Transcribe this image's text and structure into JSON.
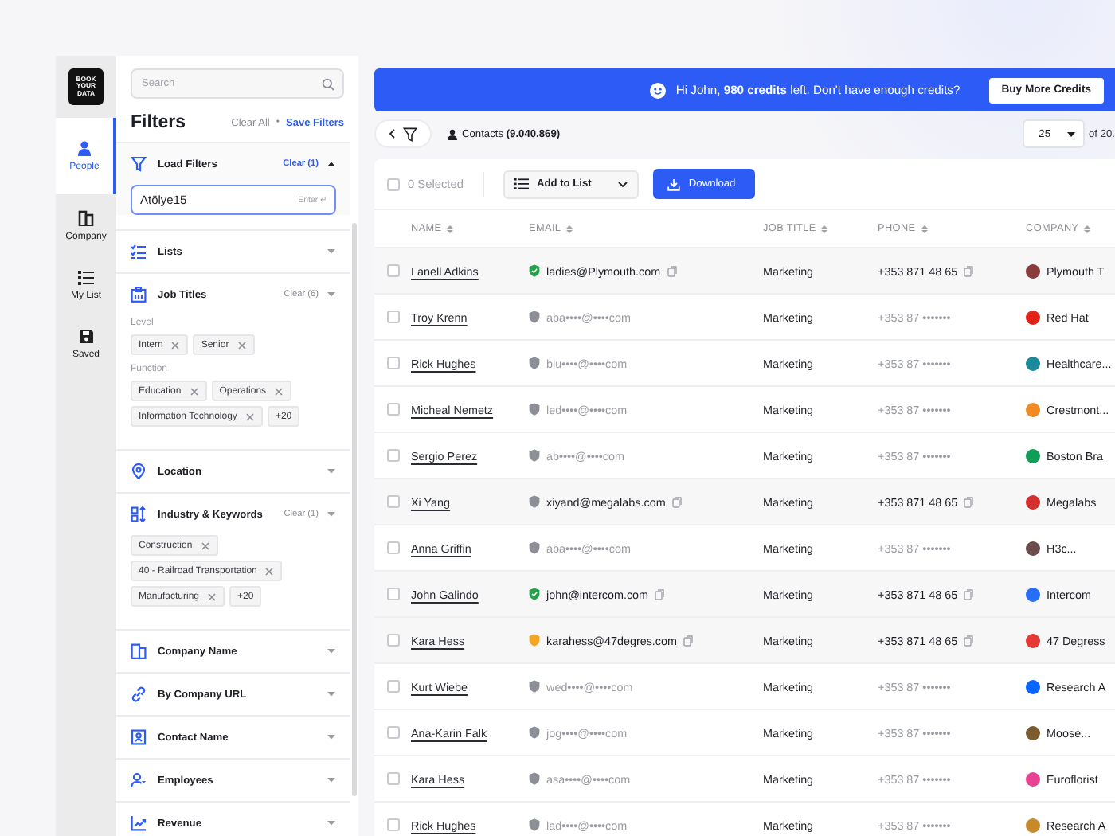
{
  "nav": {
    "logo": "BOOK YOUR DATA",
    "items": [
      {
        "label": "People",
        "selected": true
      },
      {
        "label": "Company",
        "selected": false
      },
      {
        "label": "My List",
        "selected": false
      },
      {
        "label": "Saved",
        "selected": false
      }
    ]
  },
  "filters": {
    "search": {
      "placeholder": "Search"
    },
    "title": "Filters",
    "clear_all": "Clear All",
    "separator": "•",
    "save": "Save Filters",
    "sections": [
      {
        "label": "Load Filters",
        "clear": "Clear (1)",
        "expanded": true,
        "input": {
          "value": "Atölye15",
          "hint": "Enter ↵"
        }
      },
      {
        "label": "Lists",
        "expanded": false
      },
      {
        "label": "Job Titles",
        "clear": "Clear (6)",
        "expanded": false,
        "groups": [
          {
            "label": "Level",
            "chips": [
              "Intern",
              "Senior"
            ]
          },
          {
            "label": "Function",
            "chips": [
              "Education",
              "Operations",
              "Information Technology"
            ],
            "more": "+20"
          }
        ]
      },
      {
        "label": "Location",
        "expanded": false
      },
      {
        "label": "Industry & Keywords",
        "clear": "Clear (1)",
        "expanded": false,
        "groups": [
          {
            "chips": [
              "Construction",
              "40 - Railroad Transportation",
              "Manufacturing"
            ],
            "more": "+20"
          }
        ]
      },
      {
        "label": "Company Name",
        "expanded": false
      },
      {
        "label": "By Company URL",
        "expanded": false
      },
      {
        "label": "Contact Name",
        "expanded": false
      },
      {
        "label": "Employees",
        "expanded": false
      },
      {
        "label": "Revenue",
        "expanded": false
      }
    ]
  },
  "banner": {
    "message": "Hi John, **980 credits** left. Don't have enough credits?",
    "button": "Buy More Credits"
  },
  "toolbar": {
    "contacts": "Contacts **(9.040.869)**",
    "page_size": "25",
    "page_of": "of 20."
  },
  "actions": {
    "select_all": {
      "checked": false
    },
    "selected_count": "0 Selected",
    "add_to_list": "Add to List",
    "download": "Download"
  },
  "table": {
    "columns": [
      "NAME",
      "EMAIL",
      "JOB TITLE",
      "PHONE",
      "COMPANY"
    ],
    "rows": [
      {
        "selected": false,
        "revealed": true,
        "kind": "verified",
        "name": "Lanell Adkins",
        "email": "ladies@Plymouth.com",
        "job_title": "Marketing",
        "phone": "+353 871 48 65",
        "company": "Plymouth T",
        "color": "#8a3b3b"
      },
      {
        "selected": false,
        "revealed": false,
        "kind": "unverified",
        "name": "Troy Krenn",
        "email": "aba••••@••••com",
        "job_title": "Marketing",
        "phone": "+353 87 •••••••",
        "company": "Red Hat",
        "color": "#e2231a"
      },
      {
        "selected": false,
        "revealed": false,
        "kind": "unverified",
        "name": "Rick Hughes",
        "email": "blu••••@••••com",
        "job_title": "Marketing",
        "phone": "+353 87 •••••••",
        "company": "Healthcare...",
        "color": "#1a8a9a"
      },
      {
        "selected": false,
        "revealed": false,
        "kind": "unverified",
        "name": "Micheal Nemetz",
        "email": "led••••@••••com",
        "job_title": "Marketing",
        "phone": "+353 87 •••••••",
        "company": "Crestmont...",
        "color": "#f08a24"
      },
      {
        "selected": false,
        "revealed": false,
        "kind": "unverified",
        "name": "Sergio Perez",
        "email": "ab••••@••••com",
        "job_title": "Marketing",
        "phone": "+353 87 •••••••",
        "company": "Boston Bra",
        "color": "#0f9d58"
      },
      {
        "selected": false,
        "revealed": true,
        "kind": "unverified",
        "name": "Xi Yang",
        "email": "xiyand@megalabs.com",
        "job_title": "Marketing",
        "phone": "+353 871 48 65",
        "company": "Megalabs",
        "color": "#d32f2f"
      },
      {
        "selected": false,
        "revealed": false,
        "kind": "unverified",
        "name": "Anna Griffin",
        "email": "aba••••@••••com",
        "job_title": "Marketing",
        "phone": "+353 87 •••••••",
        "company": "H3c...",
        "color": "#6b4b4b"
      },
      {
        "selected": false,
        "revealed": true,
        "kind": "verified",
        "name": "John Galindo",
        "email": "john@intercom.com",
        "job_title": "Marketing",
        "phone": "+353 871 48 65",
        "company": "Intercom",
        "color": "#286efa"
      },
      {
        "selected": false,
        "revealed": true,
        "kind": "risky",
        "name": "Kara Hess",
        "email": "karahess@47degres.com",
        "job_title": "Marketing",
        "phone": "+353 871 48 65",
        "company": "47 Degress",
        "color": "#e53935"
      },
      {
        "selected": false,
        "revealed": false,
        "kind": "unverified",
        "name": "Kurt Wiebe",
        "email": "wed••••@••••com",
        "job_title": "Marketing",
        "phone": "+353 87 •••••••",
        "company": "Research A",
        "color": "#0866ff"
      },
      {
        "selected": false,
        "revealed": false,
        "kind": "unverified",
        "name": "Ana-Karin Falk",
        "email": "jog••••@••••com",
        "job_title": "Marketing",
        "phone": "+353 87 •••••••",
        "company": "Moose...",
        "color": "#7a5c2e"
      },
      {
        "selected": false,
        "revealed": false,
        "kind": "unverified",
        "name": "Kara Hess",
        "email": "asa••••@••••com",
        "job_title": "Marketing",
        "phone": "+353 87 •••••••",
        "company": "Euroflorist",
        "color": "#e84393"
      },
      {
        "selected": false,
        "revealed": false,
        "kind": "unverified",
        "name": "Rick Hughes",
        "email": "lad••••@••••com",
        "job_title": "Marketing",
        "phone": "+353 87 •••••••",
        "company": "Research A",
        "color": "#c68a2a"
      }
    ]
  }
}
